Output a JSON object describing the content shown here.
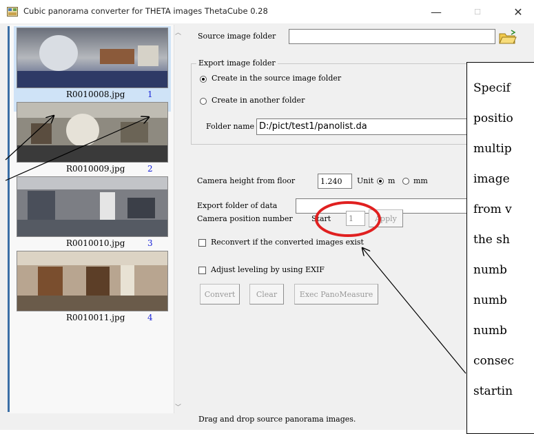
{
  "window": {
    "title": "Cubic panorama converter for THETA images ThetaCube 0.28",
    "minimize_glyph": "—",
    "maximize_glyph": "☐",
    "close_glyph": "✕"
  },
  "thumbnails": [
    {
      "filename": "R0010008.jpg",
      "number": "1"
    },
    {
      "filename": "R0010009.jpg",
      "number": "2"
    },
    {
      "filename": "R0010010.jpg",
      "number": "3"
    },
    {
      "filename": "R0010011.jpg",
      "number": "4"
    }
  ],
  "status": {
    "text": "Drag and drop source panorama images."
  },
  "source": {
    "label": "Source image folder",
    "value": ""
  },
  "export_group": {
    "title": "Export image folder",
    "option_source": "Create in the source image folder",
    "option_another": "Create in another folder",
    "folder_name_label": "Folder name",
    "folder_name_value": "D:/pict/test1/panolist.da"
  },
  "camera": {
    "height_label": "Camera height from floor",
    "height_value": "1.240",
    "unit_label": "Unit",
    "unit_m": "m",
    "unit_mm": "mm"
  },
  "export_data": {
    "label": "Export folder of data",
    "value": ""
  },
  "position": {
    "label": "Camera position number",
    "start_label": "Start",
    "start_value": "1",
    "apply_label": "Apply"
  },
  "options": {
    "reconvert": "Reconvert if the converted images exist",
    "leveling": "Adjust leveling by using EXIF"
  },
  "buttons": {
    "convert": "Convert",
    "clear": "Clear",
    "exec": "Exec PanoMeasure"
  },
  "annotation": {
    "lines": [
      "Specif",
      "positio",
      "multip",
      "image",
      "from v",
      "the sh",
      "numb",
      "numb",
      "numb",
      "consec",
      "startin"
    ]
  },
  "colors": {
    "accent_blue": "#1a24d8",
    "highlight": "#e02020",
    "selection": "#cfe3f7"
  }
}
